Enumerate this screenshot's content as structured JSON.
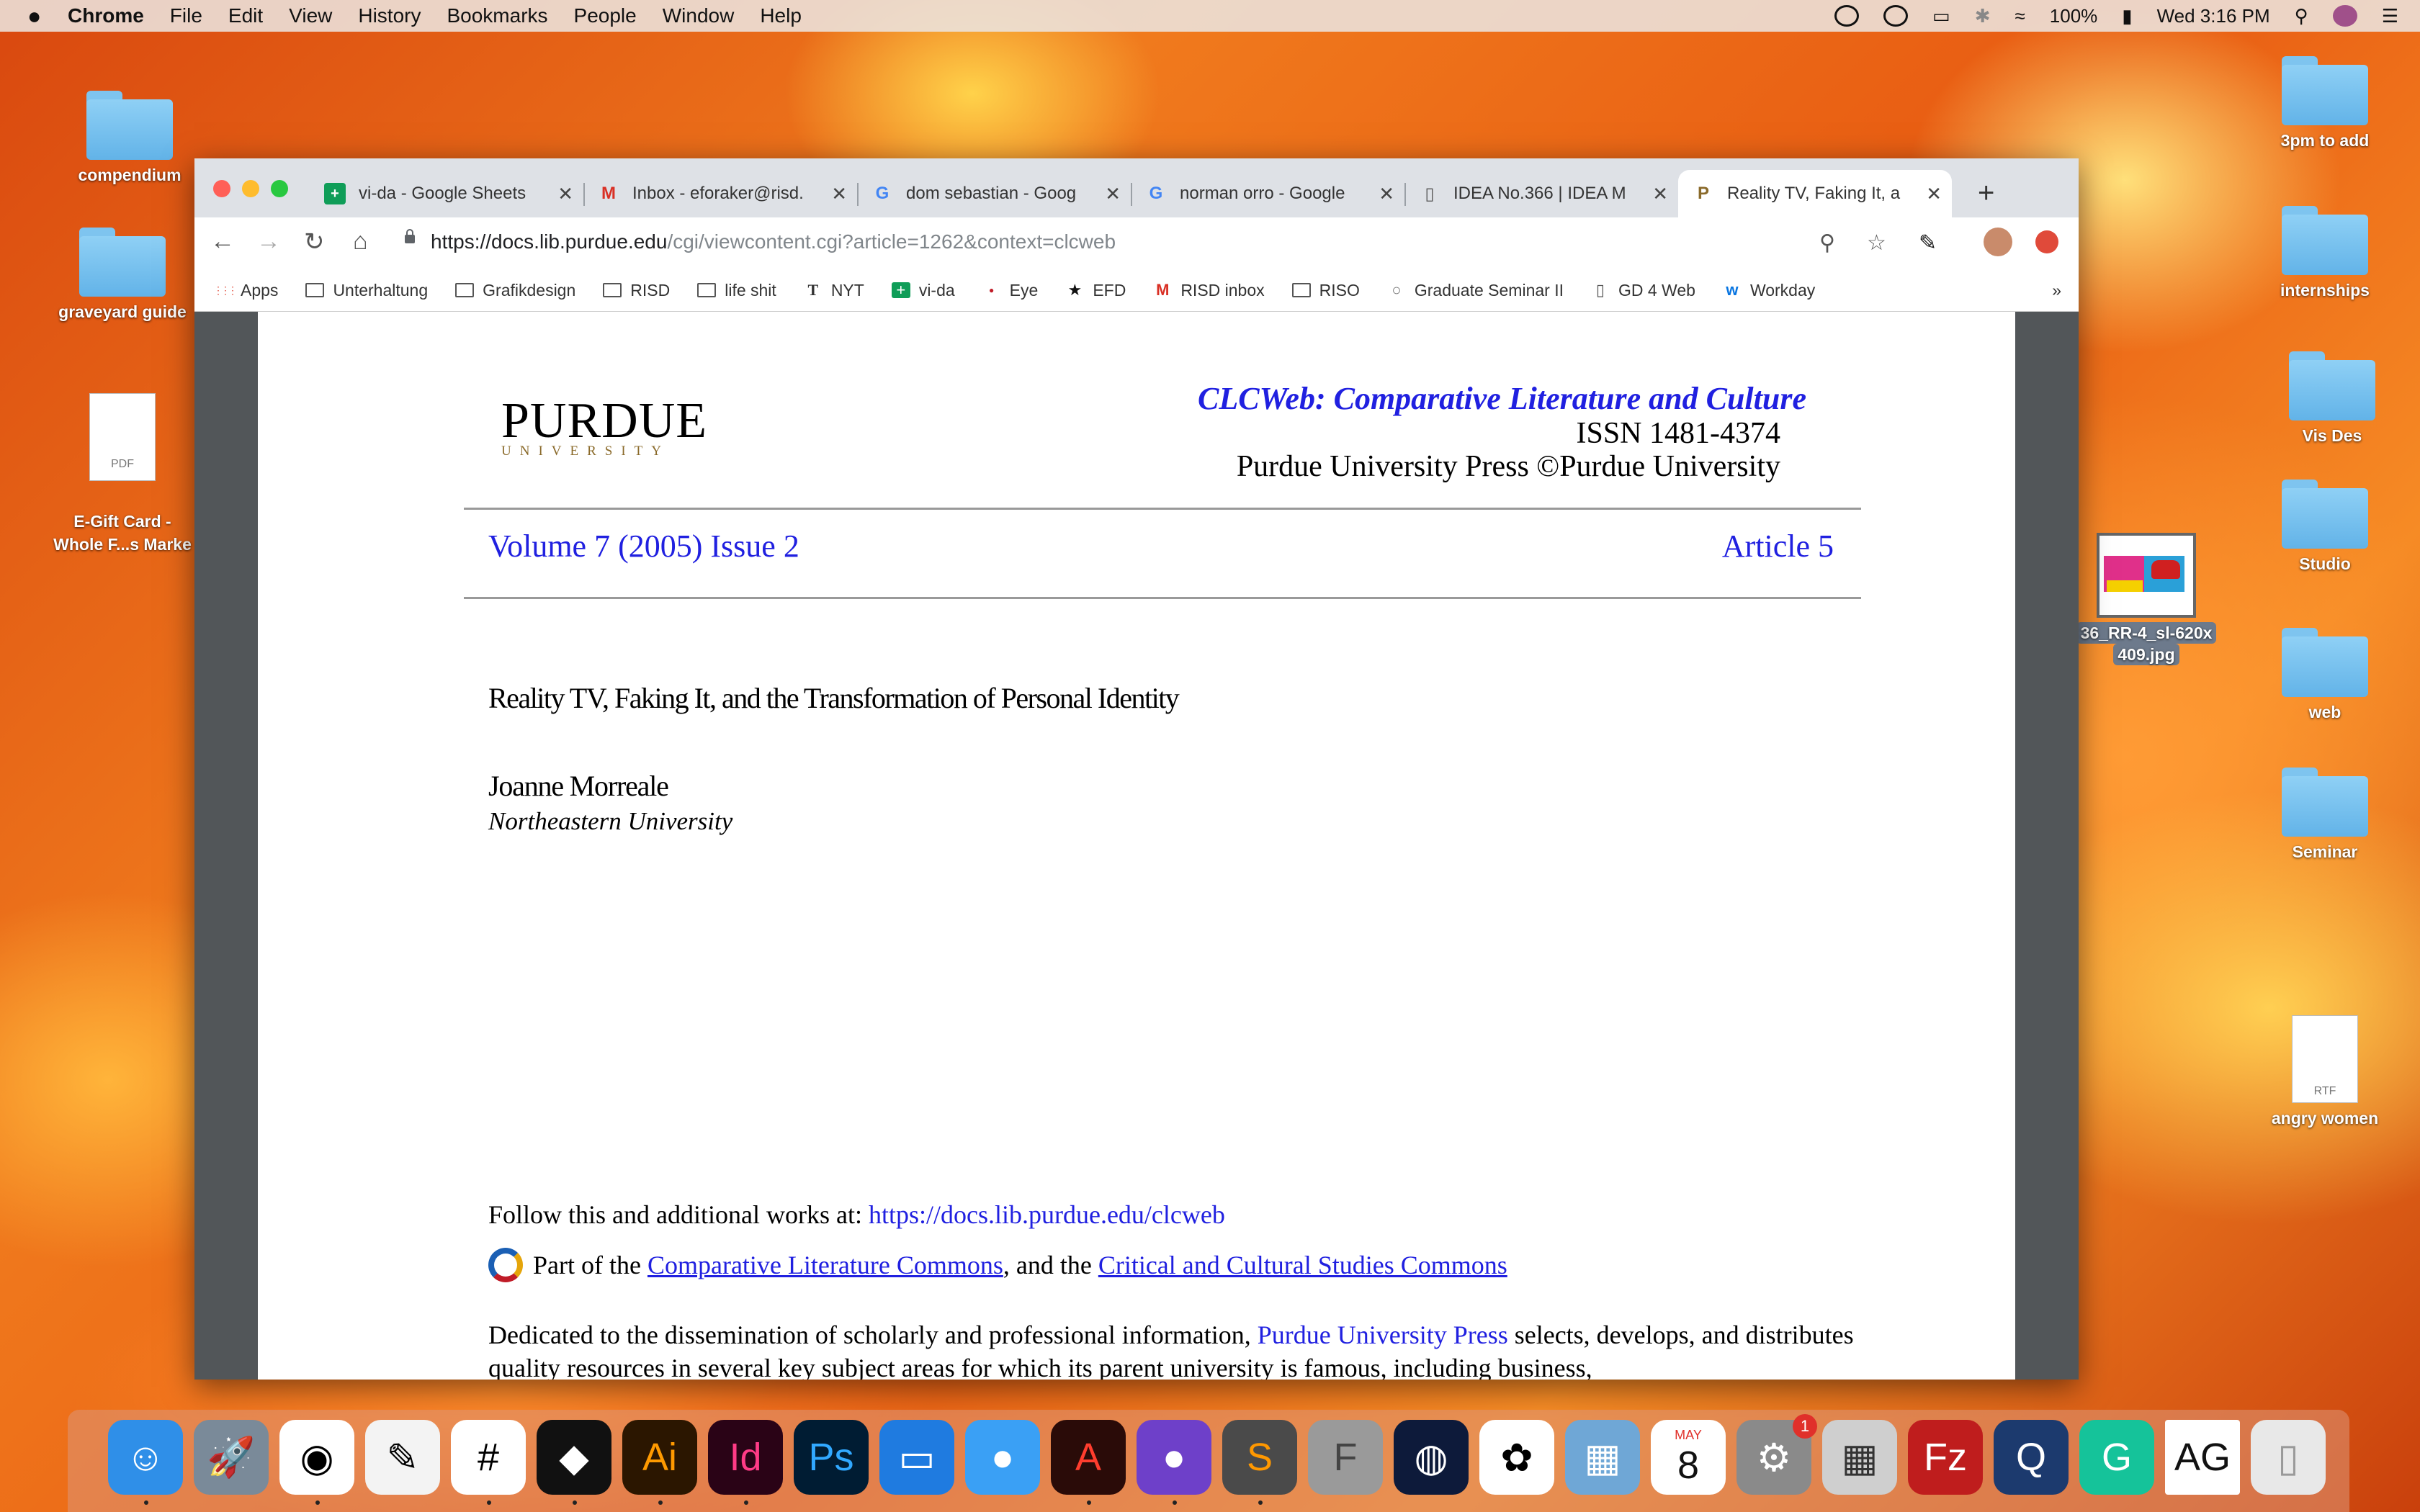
{
  "menubar": {
    "apple": "",
    "items": [
      "Chrome",
      "File",
      "Edit",
      "View",
      "History",
      "Bookmarks",
      "People",
      "Window",
      "Help"
    ],
    "battery": "100%",
    "clock": "Wed 3:16 PM"
  },
  "desktop_left": [
    {
      "label": "compendium",
      "type": "folder"
    },
    {
      "label": "graveyard guide",
      "type": "folder"
    },
    {
      "label": "E-Gift Card -\nWhole F...s Marke",
      "type": "pdf",
      "badge": "PDF"
    }
  ],
  "desktop_right": [
    {
      "label": "3pm to add",
      "type": "folder"
    },
    {
      "label": "internships",
      "type": "folder"
    },
    {
      "label": "Vis Des",
      "type": "folder"
    },
    {
      "label": "Studio",
      "type": "folder"
    },
    {
      "label": "web",
      "type": "folder"
    },
    {
      "label": "Seminar",
      "type": "folder"
    },
    {
      "label": "angry women",
      "type": "rtf",
      "badge": "RTF"
    }
  ],
  "selected_file": {
    "label_line1": "36_RR-4_sl-620x",
    "label_line2": "409.jpg"
  },
  "tabs": [
    {
      "title": "vi-da - Google Sheets",
      "icon": "sheets-icon"
    },
    {
      "title": "Inbox - eforaker@risd.",
      "icon": "gmail-icon"
    },
    {
      "title": "dom sebastian - Goog",
      "icon": "google-icon"
    },
    {
      "title": "norman orro - Google",
      "icon": "google-icon"
    },
    {
      "title": "IDEA No.366 | IDEA M",
      "icon": "page-icon"
    },
    {
      "title": "Reality TV, Faking It, a",
      "icon": "purdue-icon"
    }
  ],
  "url": {
    "host": "https://docs.lib.purdue.edu",
    "path": "/cgi/viewcontent.cgi?article=1262&context=clcweb"
  },
  "bookmarks": [
    {
      "label": "Apps",
      "icon": "apps-icon"
    },
    {
      "label": "Unterhaltung",
      "icon": "folder-icon"
    },
    {
      "label": "Grafikdesign",
      "icon": "folder-icon"
    },
    {
      "label": "RISD",
      "icon": "folder-icon"
    },
    {
      "label": "life shit",
      "icon": "folder-icon"
    },
    {
      "label": "NYT",
      "icon": "nyt-icon"
    },
    {
      "label": "vi-da",
      "icon": "sheets-icon"
    },
    {
      "label": "Eye",
      "icon": "eye-icon"
    },
    {
      "label": "EFD",
      "icon": "star-icon"
    },
    {
      "label": "RISD inbox",
      "icon": "gmail-icon"
    },
    {
      "label": "RISO",
      "icon": "folder-icon"
    },
    {
      "label": "Graduate Seminar II",
      "icon": "chat-icon"
    },
    {
      "label": "GD 4 Web",
      "icon": "page-icon"
    },
    {
      "label": "Workday",
      "icon": "workday-icon"
    }
  ],
  "bookmarks_more": "»",
  "doc": {
    "logo_main": "PURDUE",
    "logo_sub": "UNIVERSITY",
    "journal": "CLCWeb: Comparative Literature and Culture",
    "issn": "ISSN 1481-4374",
    "press": "Purdue University Press ©Purdue University",
    "volume": "Volume 7 (2005) Issue 2",
    "article": "Article 5",
    "title": "Reality TV, Faking It, and the Transformation of Personal Identity",
    "author": "Joanne Morreale",
    "affiliation": "Northeastern University",
    "follow_text": "Follow this and additional works at: ",
    "follow_link": "https://docs.lib.purdue.edu/clcweb",
    "partof_1": "Part of the ",
    "partof_link1": "Comparative Literature Commons",
    "partof_2": ", and the ",
    "partof_link2": "Critical and Cultural Studies Commons",
    "dedic_1": "Dedicated to the dissemination of scholarly and professional information, ",
    "dedic_link": "Purdue University Press",
    "dedic_2": " selects, develops, and distributes quality resources in several key subject areas for which its parent university is famous, including business,"
  },
  "dock": [
    {
      "name": "finder",
      "label": "",
      "bg": "#2f8fe8",
      "color": "#fff",
      "running": true
    },
    {
      "name": "launchpad",
      "label": "",
      "bg": "#7a8a99",
      "color": "#fff",
      "running": false
    },
    {
      "name": "chrome",
      "label": "",
      "bg": "#ffffff",
      "color": "#000",
      "running": true
    },
    {
      "name": "textedit",
      "label": "",
      "bg": "#f3f3f3",
      "color": "#000",
      "running": false
    },
    {
      "name": "slack",
      "label": "",
      "bg": "#ffffff",
      "color": "#000",
      "running": true
    },
    {
      "name": "tidal",
      "label": "",
      "bg": "#111111",
      "color": "#fff",
      "running": true
    },
    {
      "name": "illustrator",
      "label": "Ai",
      "bg": "#2b1600",
      "color": "#ff9a00",
      "running": true
    },
    {
      "name": "indesign",
      "label": "Id",
      "bg": "#2a0316",
      "color": "#ff3b86",
      "running": true
    },
    {
      "name": "photoshop",
      "label": "Ps",
      "bg": "#001c33",
      "color": "#31a8ff",
      "running": false
    },
    {
      "name": "keynote",
      "label": "",
      "bg": "#1f7be0",
      "color": "#fff",
      "running": false
    },
    {
      "name": "messages",
      "label": "",
      "bg": "#3aa0f5",
      "color": "#fff",
      "running": false
    },
    {
      "name": "acrobat",
      "label": "",
      "bg": "#2a0b08",
      "color": "#ff3d2e",
      "running": true
    },
    {
      "name": "github",
      "label": "",
      "bg": "#6e40c9",
      "color": "#fff",
      "running": true
    },
    {
      "name": "sublime",
      "label": "",
      "bg": "#4a4a4a",
      "color": "#ff9800",
      "running": true
    },
    {
      "name": "fontbook",
      "label": "F",
      "bg": "#9a9a9a",
      "color": "#444",
      "running": false
    },
    {
      "name": "cinema4d",
      "label": "",
      "bg": "#0d1a3a",
      "color": "#fff",
      "running": false
    },
    {
      "name": "photos",
      "label": "",
      "bg": "#ffffff",
      "color": "#000",
      "running": false
    },
    {
      "name": "preview",
      "label": "",
      "bg": "#6fa7d6",
      "color": "#fff",
      "running": false
    },
    {
      "name": "calendar",
      "label": "8",
      "month": "MAY",
      "bg": "#ffffff",
      "color": "#111",
      "running": false
    },
    {
      "name": "system-preferences",
      "label": "",
      "badge": "1",
      "bg": "#8a8a8a",
      "color": "#fff",
      "running": false
    },
    {
      "name": "calculator",
      "label": "",
      "bg": "#cfcfcf",
      "color": "#333",
      "running": false
    },
    {
      "name": "filezilla",
      "label": "Fz",
      "bg": "#bf1d1d",
      "color": "#fff",
      "running": false
    },
    {
      "name": "quicktime",
      "label": "",
      "bg": "#1c3a6e",
      "color": "#fff",
      "running": false
    },
    {
      "name": "grammarly",
      "label": "",
      "bg": "#15c39a",
      "color": "#fff",
      "running": false
    },
    {
      "name": "fonts-folder",
      "label": "AG",
      "bg": "#ffffff",
      "color": "#111",
      "running": false
    },
    {
      "name": "trash",
      "label": "",
      "bg": "#e8e8e8",
      "color": "#999",
      "running": false
    }
  ]
}
